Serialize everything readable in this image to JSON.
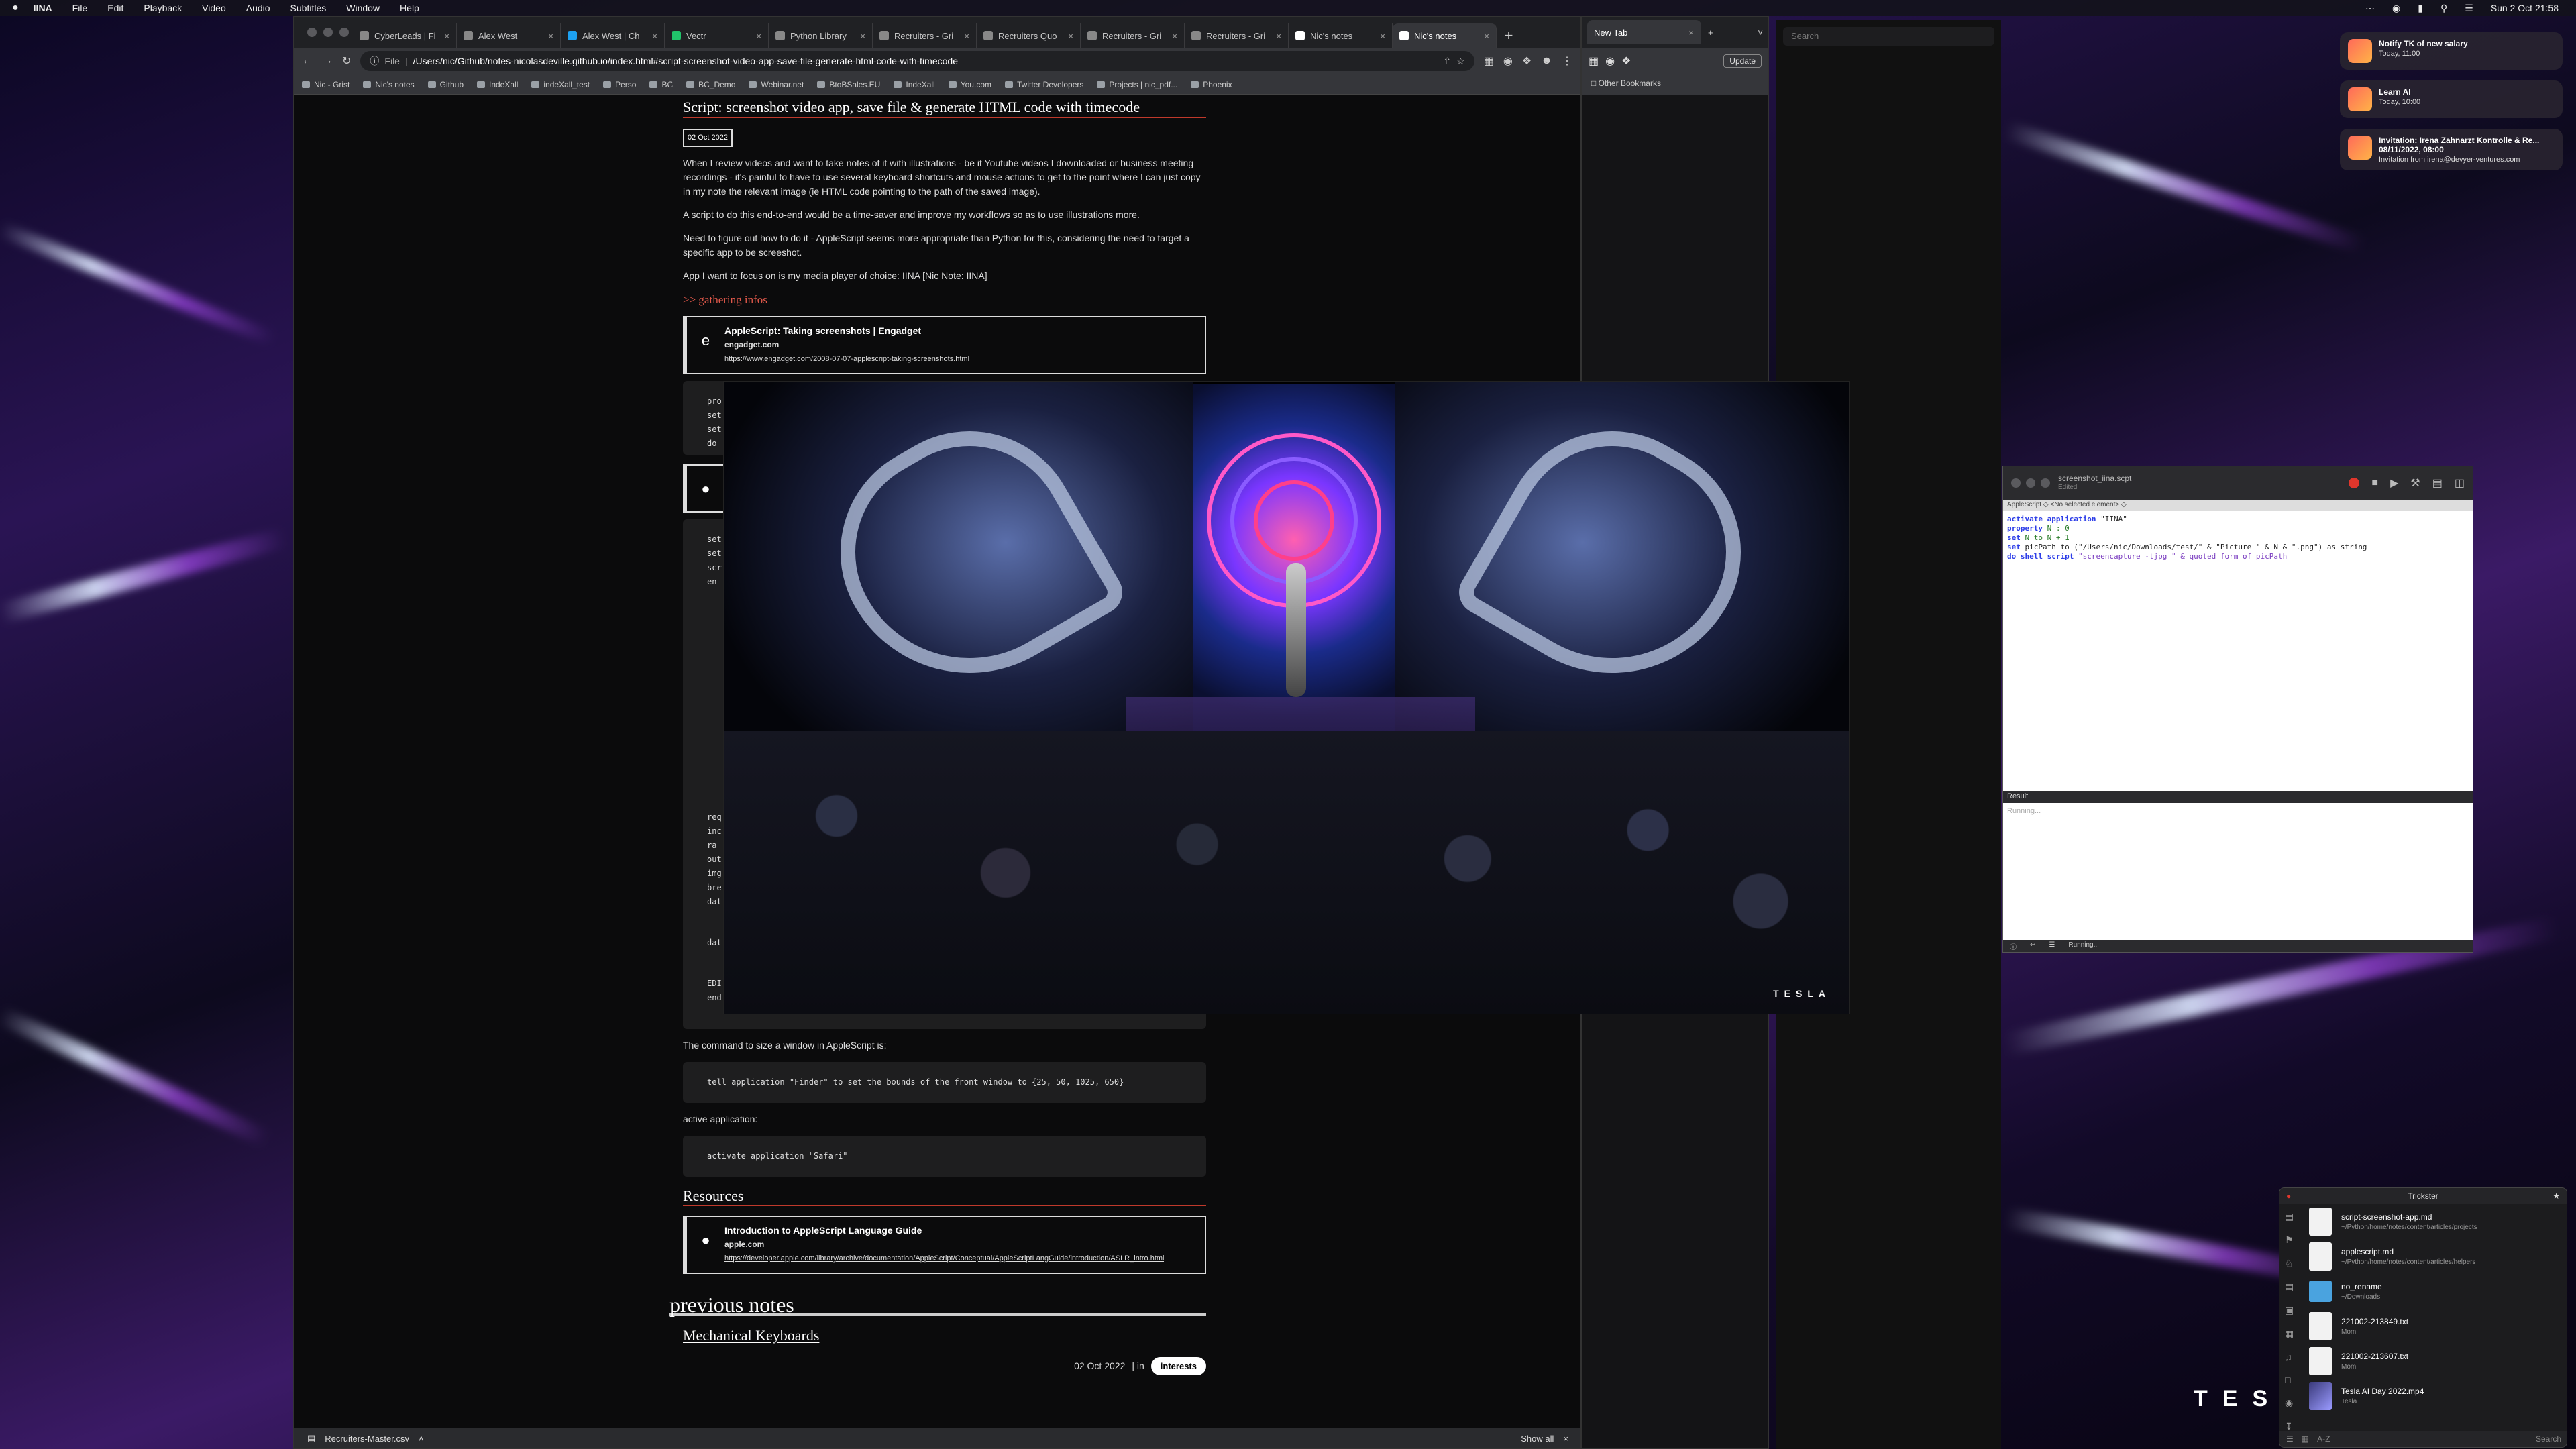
{
  "menubar": {
    "app": "IINA",
    "items": [
      "File",
      "Edit",
      "Playback",
      "Video",
      "Audio",
      "Subtitles",
      "Window",
      "Help"
    ],
    "clock": "Sun 2 Oct  21:58"
  },
  "chrome": {
    "tabs": [
      {
        "label": "CyberLeads | Fi"
      },
      {
        "label": "Alex West"
      },
      {
        "label": "Alex West | Ch"
      },
      {
        "label": "Vectr"
      },
      {
        "label": "Python Library"
      },
      {
        "label": "Recruiters - Gri"
      },
      {
        "label": "Recruiters Quo"
      },
      {
        "label": "Recruiters - Gri"
      },
      {
        "label": "Recruiters - Gri"
      },
      {
        "label": "Nic's notes"
      },
      {
        "label": "Nic's notes"
      }
    ],
    "omnibox_scheme": "File",
    "url": "/Users/nic/Github/notes-nicolasdeville.github.io/index.html#script-screenshot-video-app-save-file-generate-html-code-with-timecode",
    "bookmarks": [
      "Nic - Grist",
      "Nic's notes",
      "Github",
      "IndeXall",
      "indeXall_test",
      "Perso",
      "BC",
      "BC_Demo",
      "Webinar.net",
      "BtoBSales.EU",
      "IndeXall",
      "You.com",
      "Twitter Developers",
      "Projects | nic_pdf...",
      "Phoenix"
    ],
    "downloads_file": "Recruiters-Master.csv",
    "downloads_show_all": "Show all"
  },
  "article": {
    "title": "Script: screenshot video app, save file & generate HTML code with timecode",
    "date": "02 Oct 2022",
    "p1": "When I review videos and want to take notes of it with illustrations - be it Youtube videos I downloaded or business meeting recordings - it's painful to have to use several keyboard shortcuts and mouse actions to get to the point where I can just copy in my note the relevant image (ie HTML code pointing to the path of the saved image).",
    "p2": "A script to do this end-to-end would be a time-saver and improve my workflows so as to use illustrations more.",
    "p3": "Need to figure out how to do it - AppleScript seems more appropriate than Python for this, considering the need to target a specific app to be screeshot.",
    "p4_prefix": "App I want to focus on is my media player of choice: IINA ",
    "p4_link": "[Nic Note: IINA]",
    "gathering": ">> gathering infos",
    "card1": {
      "title": "AppleScript: Taking screenshots | Engadget",
      "site": "engadget.com",
      "url": "https://www.engadget.com/2008-07-07-applescript-taking-screenshots.html"
    },
    "code_peek": [
      "pro",
      "set",
      "set",
      "do"
    ],
    "code_peek2": [
      "set",
      "set",
      "scr",
      "",
      "en"
    ],
    "code_peek3": [
      "req",
      "inc",
      "ra",
      "",
      "out",
      "img",
      "bre",
      "dat",
      "",
      "dat",
      "",
      "EDI",
      "end"
    ],
    "window_size_intro": "The command to size a window in AppleScript is:",
    "code_window": "tell application \"Finder\" to set the bounds of the front window to {25, 50, 1025, 650}",
    "active_intro": "active application:",
    "code_active": "activate application \"Safari\"",
    "resources": "Resources",
    "card2": {
      "title": "Introduction to AppleScript Language Guide",
      "site": "apple.com",
      "url": "https://developer.apple.com/library/archive/documentation/AppleScript/Conceptual/AppleScriptLangGuide/introduction/ASLR_intro.html"
    },
    "previous_notes": "previous notes",
    "prev_title": "Mechanical Keyboards",
    "prev_date": "02 Oct 2022",
    "prev_in": "| in",
    "prev_tag": "interests"
  },
  "sidewin": {
    "tab": "New Tab",
    "update": "Update",
    "other_bookmarks": "Other Bookmarks"
  },
  "searchpane": {
    "placeholder": "Search"
  },
  "video": {
    "logo": "TESLA"
  },
  "script_editor": {
    "filename": "screenshot_iina.scpt",
    "status": "Edited",
    "target": "AppleScript  ◇  <No selected element>  ◇",
    "lines": [
      {
        "k": "activate application",
        "v": " \"IINA\""
      },
      {
        "k": "property",
        "v": " N : 0"
      },
      {
        "k": "set",
        "v": " N to N + 1"
      },
      {
        "k": "set",
        "v": " picPath to (\"/Users/nic/Downloads/test/\" & \"Picture_\" & N & \".png\") as string"
      },
      {
        "k": "do shell script",
        "v": " \"screencapture -tjpg \" & quoted form of picPath"
      }
    ],
    "result_label": "Result",
    "running": "Running...",
    "footer_running": "Running..."
  },
  "notifications": [
    {
      "title": "Notify TK of new salary",
      "sub": "Today, 11:00"
    },
    {
      "title": "Learn AI",
      "sub": "Today, 10:00"
    },
    {
      "title": "Invitation: Irena Zahnarzt Kontrolle & Re...",
      "sub": "08/11/2022, 08:00",
      "sub2": "Invitation from irena@devyer-ventures.com"
    }
  ],
  "trickster": {
    "title": "Trickster",
    "files": [
      {
        "name": "script-screenshot-app.md",
        "path": "~/Python/home/notes/content/articles/projects",
        "kind": "doc"
      },
      {
        "name": "applescript.md",
        "path": "~/Python/home/notes/content/articles/helpers",
        "kind": "doc"
      },
      {
        "name": "no_rename",
        "path": "~/Downloads",
        "kind": "folder"
      },
      {
        "name": "221002-213849.txt",
        "path": "Mom",
        "kind": "doc"
      },
      {
        "name": "221002-213607.txt",
        "path": "Mom",
        "kind": "doc"
      },
      {
        "name": "Tesla AI Day 2022.mp4",
        "path": "Tesla",
        "kind": "vid"
      }
    ],
    "footer_sort": "A-Z",
    "search": "Search"
  },
  "wallpaper_logo": "TESLA"
}
